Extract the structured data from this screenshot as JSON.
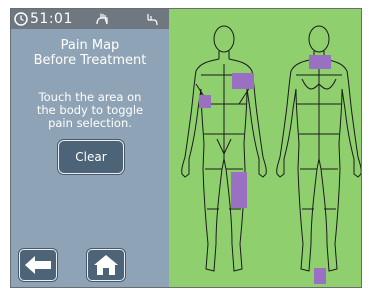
{
  "status": {
    "timer": "51:01"
  },
  "panel": {
    "title_line1": "Pain Map",
    "title_line2": "Before Treatment",
    "instr_line1": "Touch the area on",
    "instr_line2": "the body to toggle",
    "instr_line3": "pain selection.",
    "clear_label": "Clear"
  },
  "pain_map": {
    "selected_areas": [
      "front-left-chest",
      "front-right-upper-arm",
      "front-left-thigh",
      "back-neck-shoulders",
      "back-left-foot"
    ]
  },
  "colors": {
    "panel_bg": "#8fa3b6",
    "map_bg": "#8fcf6e",
    "button_bg": "#4c6378",
    "selection": "#9a70c2"
  }
}
